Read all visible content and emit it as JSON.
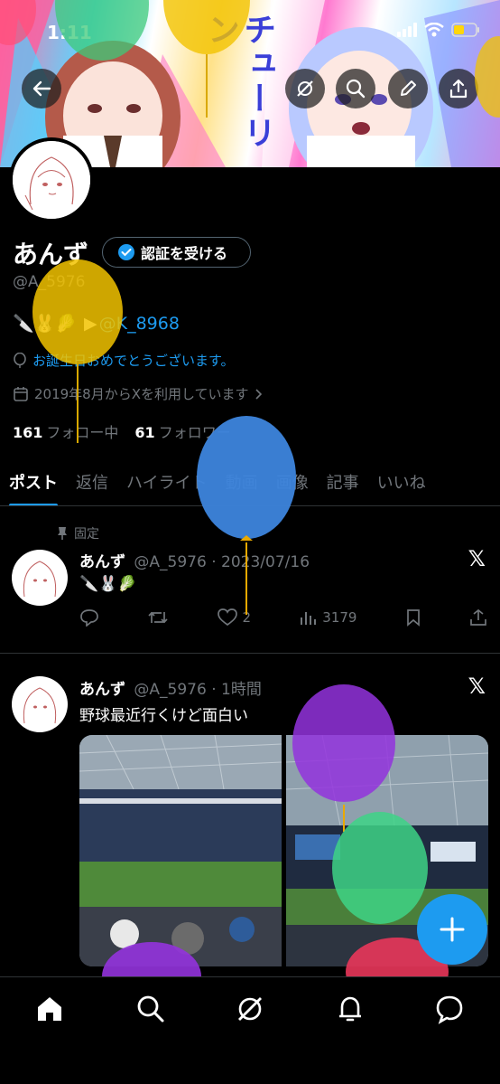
{
  "status_bar": {
    "time": "1:11"
  },
  "banner": {
    "title": "チューリン"
  },
  "profile": {
    "name": "あんず",
    "verify_button_label": "認証を受ける",
    "handle": "@A_5976",
    "bio_emojis": "🔪🐰🥬",
    "bio_arrow": "▶",
    "bio_mention": "@K_8968",
    "birthday_text": "お誕生日おめでとうございます。",
    "joined_text": "2019年8月からXを利用しています",
    "following_count": "161",
    "following_label": "フォロー中",
    "followers_count": "61",
    "followers_label": "フォロワー"
  },
  "tabs": [
    "ポスト",
    "返信",
    "ハイライト",
    "動画",
    "画像",
    "記事",
    "いいね"
  ],
  "posts": [
    {
      "pinned_label": "固定",
      "author": "あんず",
      "handle": "@A_5976",
      "separator": "·",
      "time": "2023/07/16",
      "text": "🔪🐰🥬",
      "likes": "2",
      "views": "3179"
    },
    {
      "author": "あんず",
      "handle": "@A_5976",
      "separator": "·",
      "time": "1時間",
      "text": "野球最近行くけど面白い"
    }
  ],
  "colors": {
    "accent": "#1d9bf0",
    "background": "#000000",
    "muted_text": "#71767b",
    "divider": "#2f3336"
  },
  "icons": {
    "back": "back-arrow-icon",
    "grok": "grok-icon",
    "search": "search-icon",
    "edit": "pen-icon",
    "share": "share-icon",
    "home": "home-icon",
    "notifications": "bell-icon",
    "messages": "message-icon"
  }
}
